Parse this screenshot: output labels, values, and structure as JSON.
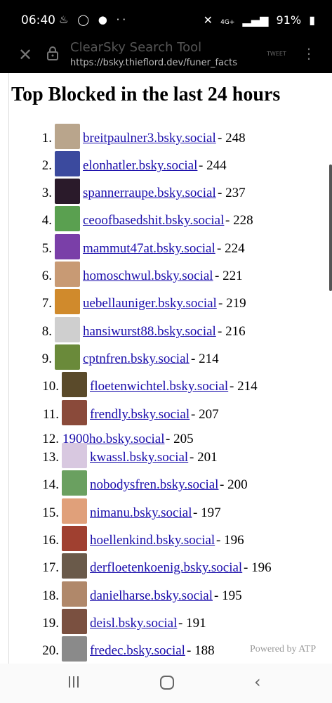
{
  "status_bar": {
    "time": "06:40",
    "battery": "91%",
    "network": "4G+"
  },
  "browser": {
    "title": "ClearSky Search Tool",
    "url": "https://bsky.thieflord.dev/funer_facts",
    "tweet_label": "TWEET"
  },
  "page": {
    "heading": "Top Blocked in the last 24 hours",
    "powered_by": "Powered by ATP"
  },
  "list": [
    {
      "rank": "1.",
      "handle": "breitpaulner3.bsky.social",
      "count": " - 248",
      "color": "#b9a58c"
    },
    {
      "rank": "2.",
      "handle": "elonhatler.bsky.social",
      "count": " - 244",
      "color": "#3b4a9e"
    },
    {
      "rank": "3.",
      "handle": "spannerraupe.bsky.social",
      "count": " - 237",
      "color": "#2a1a2a"
    },
    {
      "rank": "4.",
      "handle": "ceoofbasedshit.bsky.social",
      "count": " - 228",
      "color": "#5aa050"
    },
    {
      "rank": "5.",
      "handle": "mammut47at.bsky.social",
      "count": " - 224",
      "color": "#7a3fa8"
    },
    {
      "rank": "6.",
      "handle": "homoschwul.bsky.social",
      "count": " - 221",
      "color": "#c89a74"
    },
    {
      "rank": "7.",
      "handle": "uebellauniger.bsky.social",
      "count": " - 219",
      "color": "#d08a2c"
    },
    {
      "rank": "8.",
      "handle": "hansiwurst88.bsky.social",
      "count": " - 216",
      "color": "#cfcfcf"
    },
    {
      "rank": "9.",
      "handle": "cptnfren.bsky.social",
      "count": " - 214",
      "color": "#6a8a3a"
    },
    {
      "rank": "10.",
      "handle": "floetenwichtel.bsky.social",
      "count": " - 214",
      "color": "#5a4a2a"
    },
    {
      "rank": "11.",
      "handle": "frendly.bsky.social",
      "count": " - 207",
      "color": "#8a4a3a"
    },
    {
      "rank": "12.",
      "handle": "1900ho.bsky.social",
      "count": " - 205",
      "color": ""
    },
    {
      "rank": "13.",
      "handle": "kwassl.bsky.social",
      "count": " - 201",
      "color": "#d8c8e0"
    },
    {
      "rank": "14.",
      "handle": "nobodysfren.bsky.social",
      "count": " - 200",
      "color": "#6aa060"
    },
    {
      "rank": "15.",
      "handle": "nimanu.bsky.social",
      "count": " - 197",
      "color": "#e0a07a"
    },
    {
      "rank": "16.",
      "handle": "hoellenkind.bsky.social",
      "count": " - 196",
      "color": "#a04030"
    },
    {
      "rank": "17.",
      "handle": "derfloetenkoenig.bsky.social",
      "count": " - 196",
      "color": "#6a5a4a"
    },
    {
      "rank": "18.",
      "handle": "danielharse.bsky.social",
      "count": " - 195",
      "color": "#b0886a"
    },
    {
      "rank": "19.",
      "handle": "deisl.bsky.social",
      "count": " - 191",
      "color": "#7a5040"
    },
    {
      "rank": "20.",
      "handle": "fredec.bsky.social",
      "count": " - 188",
      "color": "#8a8a8a"
    }
  ]
}
